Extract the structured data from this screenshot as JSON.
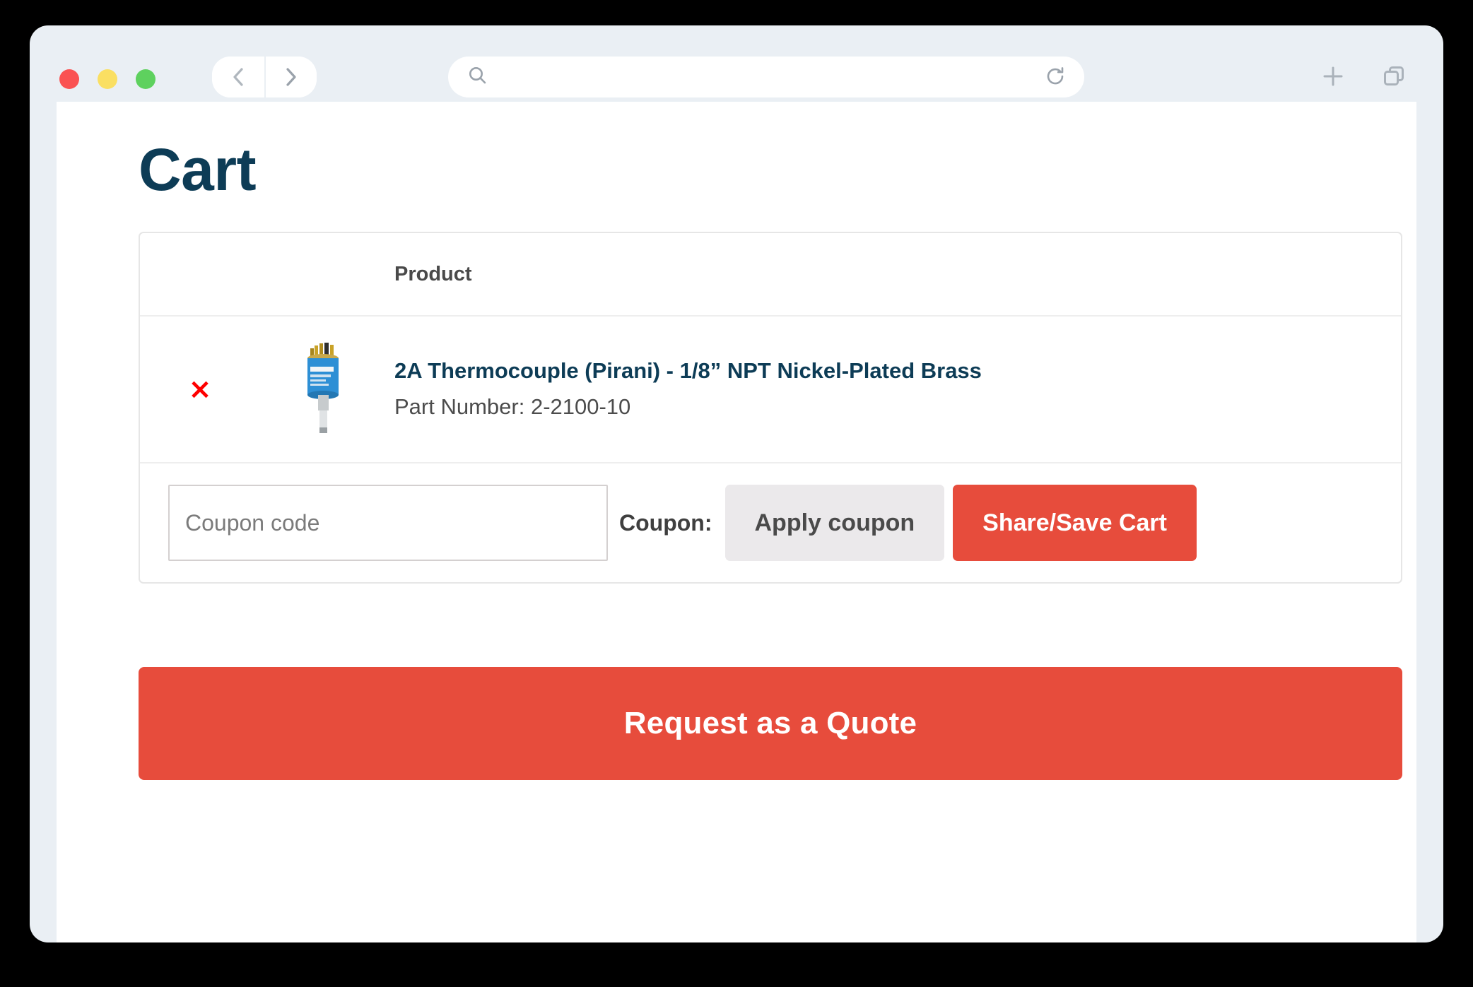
{
  "browser": {
    "traffic_lights": [
      {
        "name": "close",
        "color": "#fa5252"
      },
      {
        "name": "minimize",
        "color": "#fadf62"
      },
      {
        "name": "maximize",
        "color": "#5ed15e"
      }
    ],
    "back_icon": "chevron-left-icon",
    "forward_icon": "chevron-right-icon",
    "search_icon": "search-icon",
    "reload_icon": "reload-icon",
    "new_tab_icon": "plus-icon",
    "tab_overview_icon": "copy-tabs-icon",
    "address_value": "",
    "address_placeholder": ""
  },
  "page": {
    "title": "Cart"
  },
  "cart": {
    "columns": {
      "remove": "",
      "thumbnail": "",
      "product": "Product"
    },
    "items": [
      {
        "remove_label": "×",
        "name": "2A Thermocouple (Pirani) - 1/8” NPT Nickel-Plated Brass",
        "part_number": "Part Number: 2-2100-10",
        "thumb_alt": "product-thumbnail"
      }
    ],
    "coupon": {
      "input_value": "",
      "input_placeholder": "Coupon code",
      "label": "Coupon:",
      "apply_label": "Apply coupon",
      "share_label": "Share/Save Cart"
    },
    "quote_label": "Request as a Quote"
  },
  "colors": {
    "accent_red": "#e74c3c",
    "title_navy": "#0d3c56",
    "remove_red": "#fe0000",
    "chrome_bg": "#eaeff4"
  }
}
